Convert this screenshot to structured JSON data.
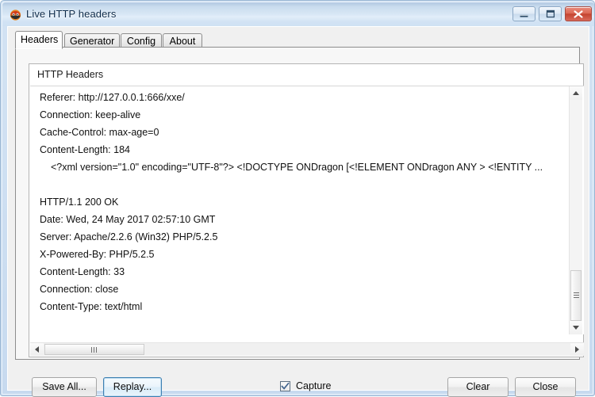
{
  "window": {
    "title": "Live HTTP headers",
    "icon": "app-icon",
    "controls": {
      "minimize": "minimize-icon",
      "maximize": "maximize-icon",
      "close": "close-icon"
    }
  },
  "tabs": [
    {
      "label": "Headers",
      "selected": true
    },
    {
      "label": "Generator",
      "selected": false
    },
    {
      "label": "Config",
      "selected": false
    },
    {
      "label": "About",
      "selected": false
    }
  ],
  "headers_group": {
    "title": "HTTP Headers",
    "lines": [
      {
        "text": "Referer: http://127.0.0.1:666/xxe/",
        "indented": false
      },
      {
        "text": "Connection: keep-alive",
        "indented": false
      },
      {
        "text": "Cache-Control: max-age=0",
        "indented": false
      },
      {
        "text": "Content-Length: 184",
        "indented": false
      },
      {
        "text": "<?xml version=\"1.0\" encoding=\"UTF-8\"?> <!DOCTYPE ONDragon [<!ELEMENT ONDragon ANY > <!ENTITY ...",
        "indented": true
      },
      {
        "text": "",
        "indented": false
      },
      {
        "text": "HTTP/1.1 200 OK",
        "indented": false
      },
      {
        "text": "Date: Wed, 24 May 2017 02:57:10 GMT",
        "indented": false
      },
      {
        "text": "Server: Apache/2.2.6 (Win32) PHP/5.2.5",
        "indented": false
      },
      {
        "text": "X-Powered-By: PHP/5.2.5",
        "indented": false
      },
      {
        "text": "Content-Length: 33",
        "indented": false
      },
      {
        "text": "Connection: close",
        "indented": false
      },
      {
        "text": "Content-Type: text/html",
        "indented": false
      }
    ]
  },
  "scrollbars": {
    "vertical": {
      "up_arrow": "scroll-up-icon",
      "down_arrow": "scroll-down-icon",
      "thumb": "scroll-thumb"
    },
    "horizontal": {
      "left_arrow": "scroll-left-icon",
      "right_arrow": "scroll-right-icon",
      "thumb": "scroll-thumb"
    }
  },
  "footer": {
    "save_all_label": "Save All...",
    "replay_label": "Replay...",
    "capture_label": "Capture",
    "capture_checked": true,
    "clear_label": "Clear",
    "close_label": "Close"
  },
  "colors": {
    "frame": "#c7daef",
    "title_text": "#0b2a4a",
    "close_button": "#c44430",
    "focus_ring": "#3c7fb1",
    "list_background": "#ffffff",
    "checkbox_check": "#42658f"
  }
}
